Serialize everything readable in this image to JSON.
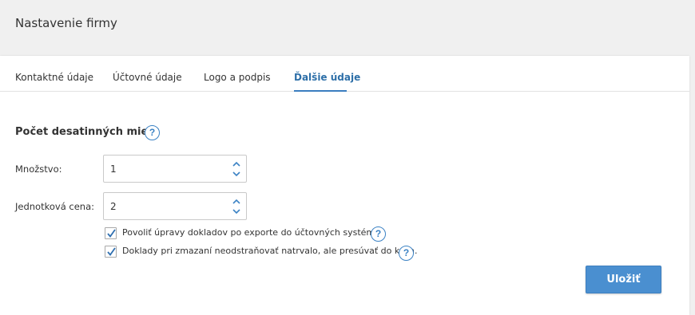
{
  "page": {
    "title": "Nastavenie firmy"
  },
  "tabs": [
    {
      "label": "Kontaktné údaje",
      "active": false
    },
    {
      "label": "Účtovné údaje",
      "active": false
    },
    {
      "label": "Logo a podpis",
      "active": false
    },
    {
      "label": "Ďalšie údaje",
      "active": true
    }
  ],
  "section": {
    "title": "Počet desatinných miest"
  },
  "fields": {
    "quantity": {
      "label": "Množstvo:",
      "value": "1"
    },
    "unit_price": {
      "label": "Jednotková cena:",
      "value": "2"
    }
  },
  "checkboxes": [
    {
      "label": "Povoliť úpravy dokladov po exporte do účtovných systémov",
      "checked": true
    },
    {
      "label": "Doklady pri zmazaní neodstraňovať natrvalo, ale presúvať do koša.",
      "checked": true
    }
  ],
  "buttons": {
    "save_label": "Uložiť"
  },
  "icons": {
    "help": "?"
  },
  "colors": {
    "accent": "#4a8fd0",
    "active_tab": "#2d6fa8",
    "help_icon": "#3b82c4"
  }
}
